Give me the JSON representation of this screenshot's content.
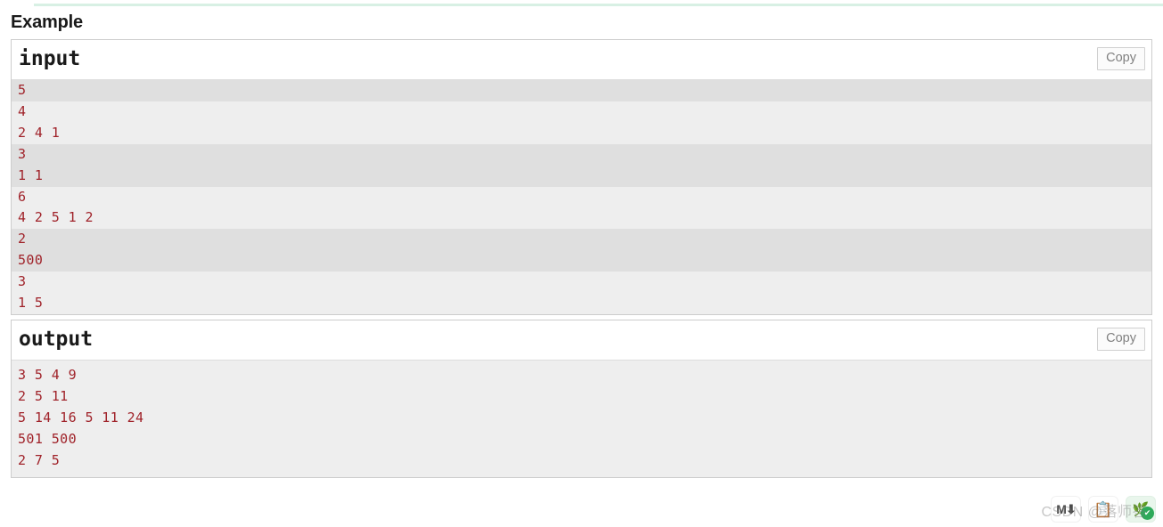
{
  "page": {
    "section_title": "Example",
    "accent_rule_color": "#d8f0e4"
  },
  "input_panel": {
    "title": "input",
    "copy_label": "Copy",
    "lines": [
      "5",
      "4",
      "2 4 1",
      "3",
      "1 1",
      "6",
      "4 2 5 1 2",
      "2",
      "500",
      "3",
      "1 5"
    ]
  },
  "output_panel": {
    "title": "output",
    "copy_label": "Copy",
    "lines": [
      "3 5 4 9",
      "2 5 11",
      "5 14 16 5 11 24",
      "501 500",
      "2 7 5"
    ]
  },
  "bottom_bar": {
    "markdown_label": "M",
    "markdown_arrow": "⬇",
    "clipboard_glyph": "📋",
    "leaf_glyph": "🌿",
    "badge_glyph": "✔",
    "watermark": "CSDN @落师答"
  },
  "colors": {
    "code_text": "#a0232a",
    "stripe_dark": "#dfdfdf",
    "stripe_light": "#eeeeee",
    "border": "#cccccc"
  }
}
